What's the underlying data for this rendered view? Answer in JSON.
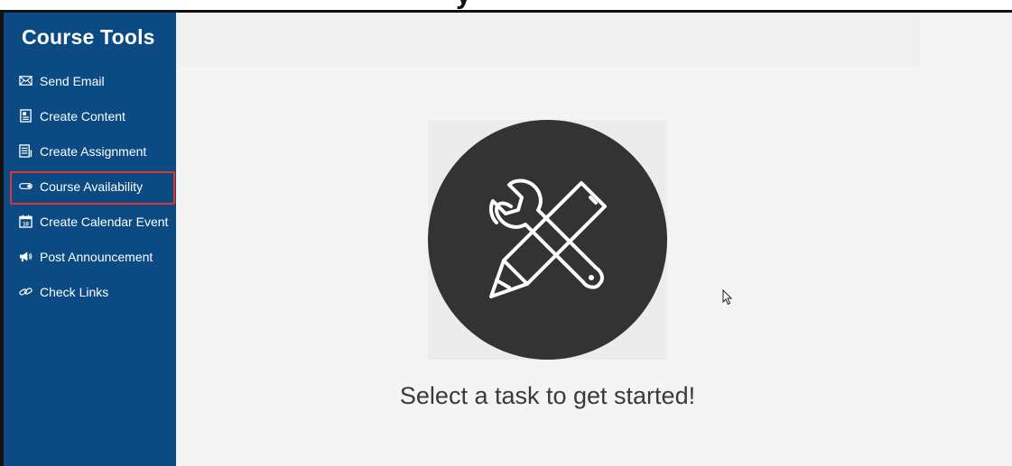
{
  "sidebar": {
    "title": "Course Tools",
    "items": [
      {
        "label": "Send Email",
        "icon": "envelope-icon"
      },
      {
        "label": "Create Content",
        "icon": "document-icon"
      },
      {
        "label": "Create Assignment",
        "icon": "assignment-icon"
      },
      {
        "label": "Course Availability",
        "icon": "toggle-icon",
        "selected": true
      },
      {
        "label": "Create Calendar Event",
        "icon": "calendar-icon"
      },
      {
        "label": "Post Announcement",
        "icon": "megaphone-icon"
      },
      {
        "label": "Check Links",
        "icon": "link-icon"
      }
    ]
  },
  "main": {
    "prompt": "Select a task to get started!",
    "illustration_icon": "tools-icon"
  },
  "colors": {
    "sidebar_bg": "#0b4a82",
    "highlight_border": "#e0332e",
    "main_bg": "#f4f4f4",
    "circle_bg": "#333333"
  }
}
